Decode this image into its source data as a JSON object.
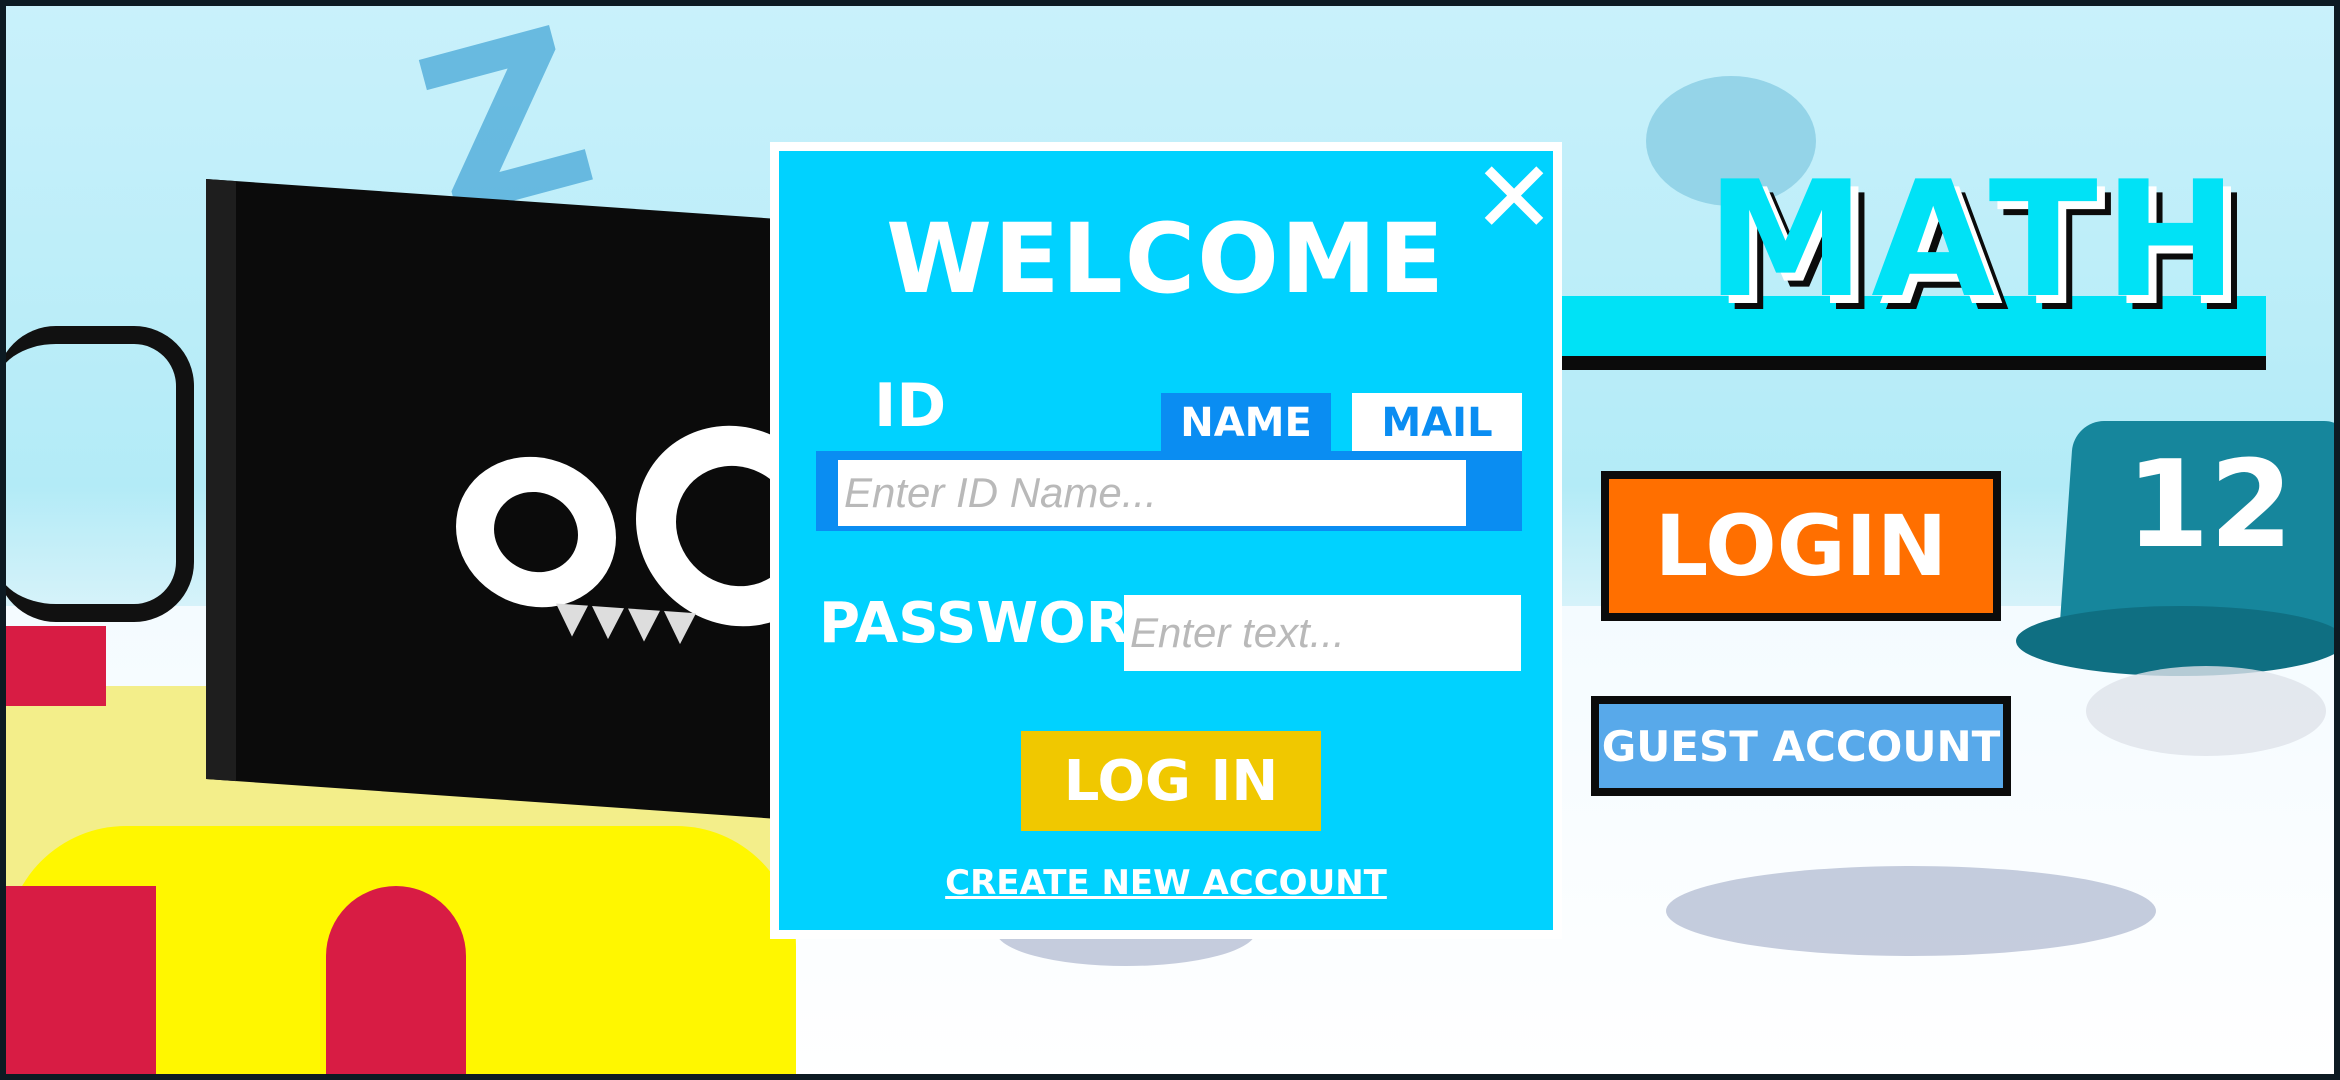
{
  "background": {
    "game_title": "MATH",
    "hat_number": "12",
    "login_button_label": "LOGIN",
    "guest_button_label": "GUEST ACCOUNT"
  },
  "dialog": {
    "title": "WELCOME",
    "close_icon": "✕",
    "id_label": "ID",
    "tabs": [
      {
        "label": "NAME",
        "selected": true
      },
      {
        "label": "MAIL",
        "selected": false
      }
    ],
    "id_placeholder": "Enter ID Name...",
    "password_label": "PASSWORD",
    "password_placeholder": "Enter text...",
    "submit_label": "LOG IN",
    "create_account_label": "CREATE NEW ACCOUNT"
  },
  "colors": {
    "dialog_bg": "#00d2ff",
    "tab_active": "#0a8df2",
    "login_orange": "#ff6f00",
    "submit_yellow": "#f0c800",
    "guest_blue": "#58a9ea"
  }
}
